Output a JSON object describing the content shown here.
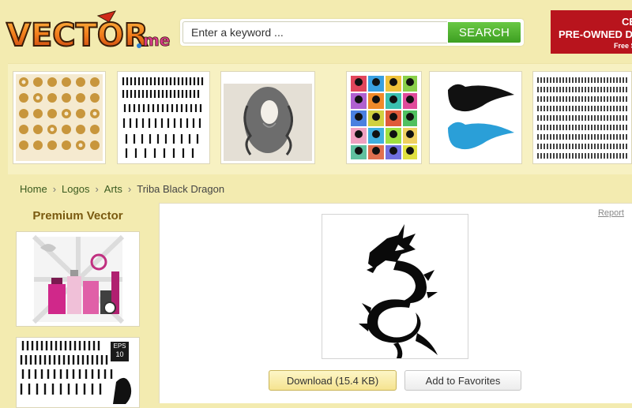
{
  "brand": {
    "name": "VECTOR.ME",
    "logo_icon": "vector-me-logo"
  },
  "search": {
    "placeholder": "Enter a keyword ...",
    "button_label": "SEARCH"
  },
  "ad": {
    "line1": "CERT",
    "line2": "PRE-OWNED DE",
    "line3": "Free S"
  },
  "thumbnails": [
    {
      "icon": "ornament-tiles-thumb"
    },
    {
      "icon": "people-silhouettes-thumb"
    },
    {
      "icon": "curly-hair-woman-thumb"
    },
    {
      "icon": "colored-head-silhouettes-thumb"
    },
    {
      "icon": "flowing-hair-silhouettes-thumb"
    },
    {
      "icon": "crowd-silhouettes-thumb"
    }
  ],
  "breadcrumb": {
    "home": "Home",
    "logos": "Logos",
    "arts": "Arts",
    "sep": "›",
    "current": "Triba Black Dragon"
  },
  "sidebar": {
    "title": "Premium Vector",
    "cards": [
      {
        "icon": "cosmetics-vector-thumb"
      },
      {
        "icon": "silhouettes-eps-thumb",
        "badge_line1": "EPS",
        "badge_line2": "10"
      }
    ]
  },
  "main": {
    "report_label": "Report",
    "preview_icon": "tribal-dragon-icon",
    "download_label": "Download (15.4 KB)",
    "favorites_label": "Add to Favorites"
  },
  "colors": {
    "page_bg": "#f3ebb0",
    "search_green": "#4aab2a",
    "ad_red": "#b8141d",
    "link_green": "#3a5a1f"
  }
}
